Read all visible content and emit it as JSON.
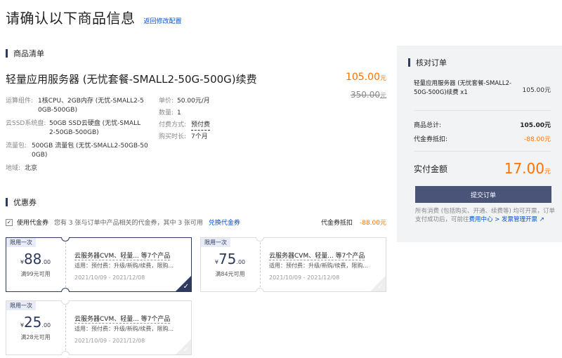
{
  "header": {
    "title": "请确认以下商品信息",
    "back_link": "返回修改配置"
  },
  "product_section": {
    "title": "商品清单",
    "product_name": "轻量应用服务器 (无忧套餐-SMALL2-50G-500G)续费",
    "price_now": "105.00",
    "price_old": "350.00",
    "currency_unit": "元",
    "specs_left": [
      {
        "key": "运算组件:",
        "lines": [
          "1核CPU、2GB内存 (无忧-SMALL2-5",
          "0GB-500GB)"
        ]
      },
      {
        "key": "云SSD系统盘:",
        "lines": [
          "50GB SSD云硬盘 (无忧-SMALL",
          "2-50GB-500GB)"
        ]
      },
      {
        "key": "流量包:",
        "lines": [
          "500GB 流量包 (无忧-SMALL2-50GB-50",
          "0GB)"
        ]
      },
      {
        "key": "地域:",
        "lines": [
          "北京"
        ]
      }
    ],
    "specs_right": [
      {
        "key": "单价:",
        "value": "50.00元/月"
      },
      {
        "key": "数量:",
        "value": "1"
      },
      {
        "key": "付费方式:",
        "value": "预付费"
      },
      {
        "key": "购买时长:",
        "value": "7个月"
      }
    ]
  },
  "voucher_section": {
    "title": "优惠券",
    "use_label": "使用代金券",
    "desc": "您有 3 张与订单中产品相关的代金券，其中 3 张可用",
    "redeem_link": "兑换代金券",
    "deduct_label": "代金券抵扣",
    "deduct_value": "-88.00元",
    "coupons": [
      {
        "tag": "限用一次",
        "currency": "¥",
        "amount": "88",
        "decimal": ".00",
        "condition": "满99元可用",
        "scope": "云服务器CVM、轻量... 等7个产品",
        "rule": "适用：预付费：升级/新购/续费，限购...",
        "date": "2021/10/09 - 2021/12/08",
        "check": "✓"
      },
      {
        "tag": "限用一次",
        "currency": "¥",
        "amount": "75",
        "decimal": ".00",
        "condition": "满84元可用",
        "scope": "云服务器CVM、轻量... 等7个产品",
        "rule": "适用：预付费：升级/新购/续费，限购...",
        "date": "2021/10/09 - 2021/12/08",
        "check": "✓"
      },
      {
        "tag": "限用一次",
        "currency": "¥",
        "amount": "25",
        "decimal": ".00",
        "condition": "满28元可用",
        "scope": "云服务器CVM、轻量... 等7个产品",
        "rule": "适用：预付费：升级/新购/续费，限购...",
        "date": "2021/10/09 - 2021/12/08",
        "check": "✓"
      }
    ]
  },
  "summary": {
    "title": "核对订单",
    "item_name": "轻量应用服务器 (无忧套餐-SMALL2-50G-500G)续费 x1",
    "item_price": "105.00元",
    "total_label": "商品总计:",
    "total_value": "105.00元",
    "voucher_label": "代金券抵扣:",
    "voucher_value": "-88.00元",
    "pay_label": "实付金额",
    "pay_amount": "17.00",
    "pay_unit": "元",
    "submit_label": "提交订单",
    "note_prefix": "所有消费 (包括购买、开通、续费等) 均可开票，订单支付成功后，可前往",
    "note_link": "费用中心 > 发票管理开票",
    "note_icon": "external-link-icon"
  },
  "colors": {
    "accent": "#2f3a5f",
    "price": "#ff7200",
    "link": "#0052d9",
    "button": "#4a5478"
  }
}
